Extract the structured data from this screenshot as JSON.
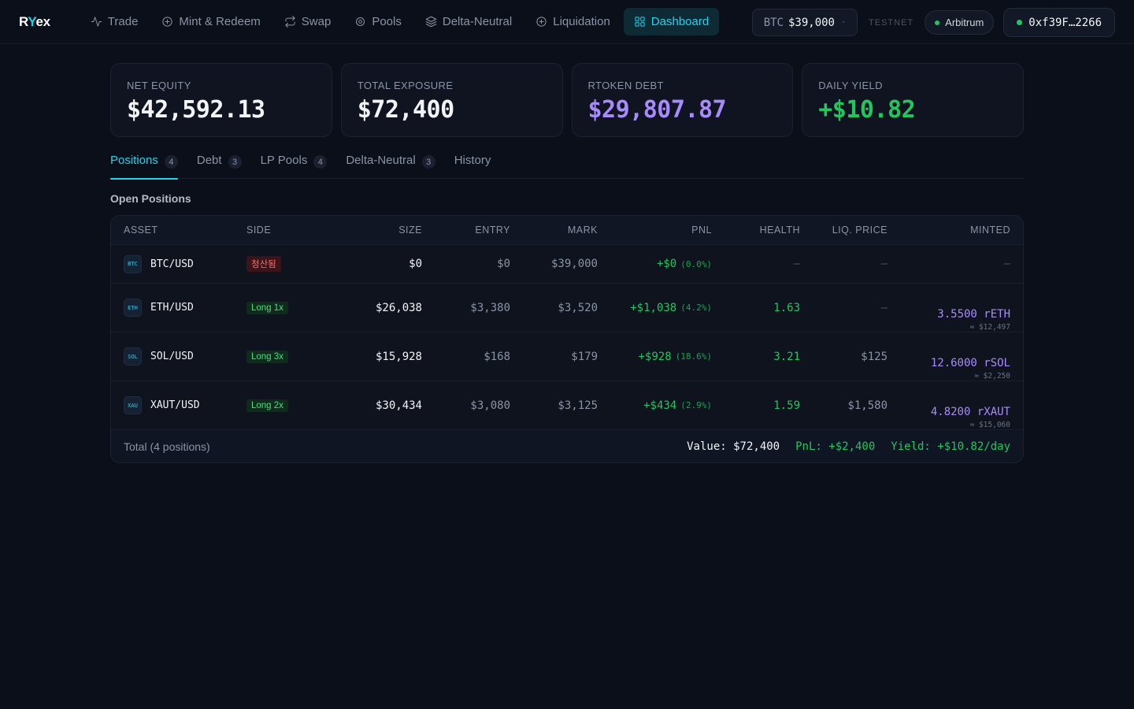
{
  "nav": {
    "logo_prefix": "R",
    "logo_accent": "Y",
    "logo_suffix": "ex",
    "items": [
      {
        "label": "Trade",
        "icon": "activity-icon"
      },
      {
        "label": "Mint & Redeem",
        "icon": "plus-circle-icon"
      },
      {
        "label": "Swap",
        "icon": "repeat-icon"
      },
      {
        "label": "Pools",
        "icon": "target-icon"
      },
      {
        "label": "Delta-Neutral",
        "icon": "layers-icon"
      },
      {
        "label": "Liquidation",
        "icon": "plus-circle-icon"
      },
      {
        "label": "Dashboard",
        "icon": "grid-icon",
        "active": true
      }
    ],
    "price_symbol": "BTC",
    "price_value": "$39,000",
    "price_dot": "·",
    "network_label": "TESTNET",
    "chain": "Arbitrum",
    "wallet": "0xf39F…2266"
  },
  "stats": [
    {
      "label": "NET EQUITY",
      "value": "$42,592.13"
    },
    {
      "label": "TOTAL EXPOSURE",
      "value": "$72,400"
    },
    {
      "label": "RTOKEN DEBT",
      "value": "$29,807.87"
    },
    {
      "label": "DAILY YIELD",
      "value": "+$10.82"
    }
  ],
  "tabs": [
    {
      "label": "Positions",
      "count": "4",
      "active": true
    },
    {
      "label": "Debt",
      "count": "3"
    },
    {
      "label": "LP Pools",
      "count": "4"
    },
    {
      "label": "Delta-Neutral",
      "count": "3"
    },
    {
      "label": "History",
      "count": ""
    }
  ],
  "section_title": "Open Positions",
  "table": {
    "headers": {
      "asset": "ASSET",
      "side": "SIDE",
      "size": "SIZE",
      "entry": "ENTRY",
      "mark": "MARK",
      "pnl": "PNL",
      "health": "HEALTH",
      "liq": "LIQ. PRICE",
      "minted": "MINTED"
    },
    "rows": [
      {
        "icon": "BTC",
        "asset": "BTC/USD",
        "side": "청산됨",
        "size": "$0",
        "entry": "$0",
        "mark": "$39,000",
        "pnl": "+$0",
        "pnl_pct": "(0.0%)",
        "health": "—",
        "liq": "–",
        "minted": "—",
        "minted_usd": ""
      },
      {
        "icon": "ETH",
        "asset": "ETH/USD",
        "side": "Long 1x",
        "size": "$26,038",
        "entry": "$3,380",
        "mark": "$3,520",
        "pnl": "+$1,038",
        "pnl_pct": "(4.2%)",
        "health": "1.63",
        "liq": "–",
        "minted": "3.5500 rETH",
        "minted_usd": "≈ $12,497"
      },
      {
        "icon": "SOL",
        "asset": "SOL/USD",
        "side": "Long 3x",
        "size": "$15,928",
        "entry": "$168",
        "mark": "$179",
        "pnl": "+$928",
        "pnl_pct": "(18.6%)",
        "health": "3.21",
        "liq": "$125",
        "minted": "12.6000 rSOL",
        "minted_usd": "≈ $2,250"
      },
      {
        "icon": "XAU",
        "asset": "XAUT/USD",
        "side": "Long 2x",
        "size": "$30,434",
        "entry": "$3,080",
        "mark": "$3,125",
        "pnl": "+$434",
        "pnl_pct": "(2.9%)",
        "health": "1.59",
        "liq": "$1,580",
        "minted": "4.8200 rXAUT",
        "minted_usd": "≈ $15,060"
      }
    ],
    "total": {
      "label": "Total (4 positions)",
      "value": "Value: $72,400",
      "pnl": "PnL: +$2,400",
      "yield": "Yield: +$10.82/day"
    }
  },
  "colors": {
    "accent": "#22d3ee",
    "positive": "#22c55e",
    "negative": "#f87171",
    "purple": "#a78bfa",
    "background": "#0b0f19"
  }
}
